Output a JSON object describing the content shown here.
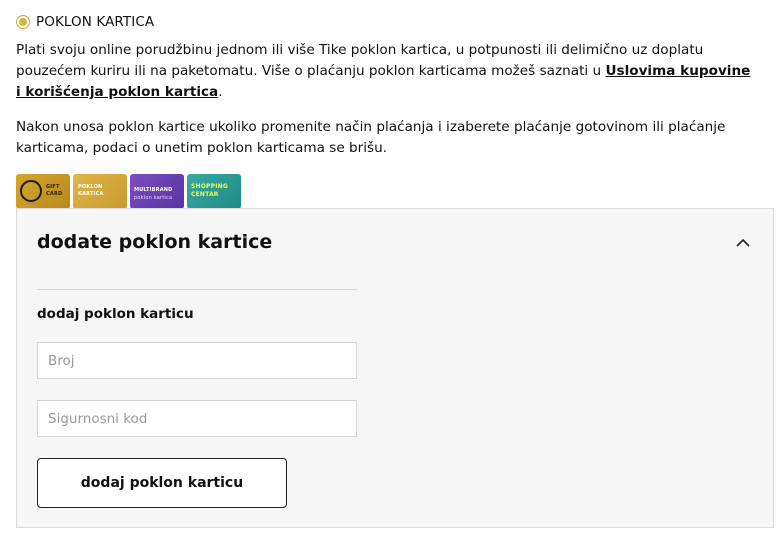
{
  "payment_option": {
    "label": "POKLON KARTICA",
    "selected": true
  },
  "description": {
    "p1_before_link": "Plati svoju online porudžbinu jednom ili više Tike poklon kartica, u potpunosti ili delimično uz doplatu pouzećem kuriru ili na paketomatu. Više o plaćanju poklon karticama možeš saznati u ",
    "p1_link": "Uslovima kupovine i korišćenja poklon kartica",
    "p1_after_link": ".",
    "p2": "Nakon unosa poklon kartice ukoliko promenite način plaćanja i izaberete plaćanje gotovinom ili plaćanje karticama, podaci o unetim poklon karticama se brišu."
  },
  "cards": [
    {
      "name": "gift-card",
      "lines": [
        "GIFT",
        "CARD"
      ]
    },
    {
      "name": "poklon-kartica-card",
      "lines": [
        "POKLON",
        "KARTICA"
      ]
    },
    {
      "name": "multibrand-card",
      "lines": [
        "MULTIBRAND",
        "poklon kartica"
      ]
    },
    {
      "name": "shopping-centar-card",
      "lines": [
        "SHOPPING",
        "CENTAR"
      ]
    }
  ],
  "panel": {
    "title": "dodate poklon kartice",
    "expanded": true,
    "section_label": "dodaj poklon karticu",
    "broj_placeholder": "Broj",
    "kod_placeholder": "Sigurnosni kod",
    "submit_label": "dodaj poklon karticu"
  },
  "colors": {
    "accent": "#d9b43a",
    "panel_bg": "#f6f6f6",
    "border": "#dcdcdc"
  },
  "icons": {
    "collapse": "chevron-up-icon",
    "radio": "radio-selected-icon"
  }
}
